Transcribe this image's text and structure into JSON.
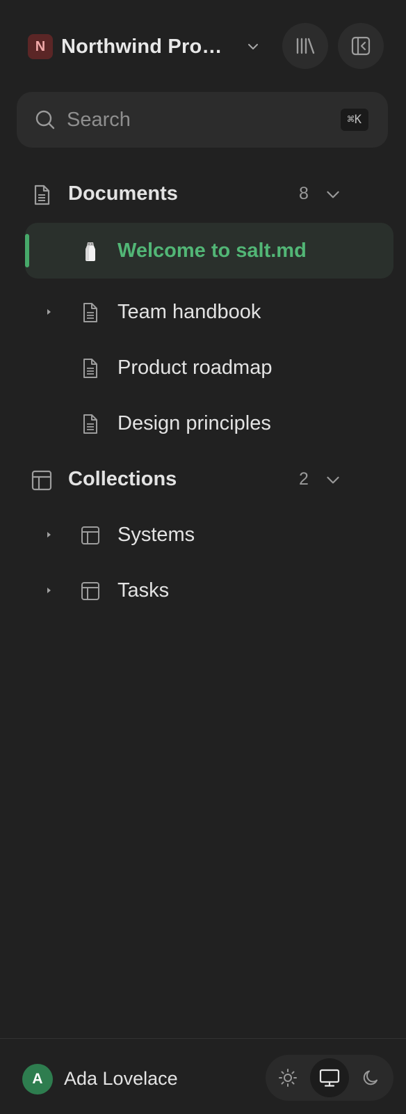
{
  "workspace": {
    "badge": "N",
    "name": "Northwind Pro…"
  },
  "search": {
    "placeholder": "Search",
    "shortcut": "⌘K"
  },
  "documents": {
    "title": "Documents",
    "count": "8",
    "items": [
      {
        "label": "Welcome to salt.md",
        "icon": "salt-shaker-icon",
        "active": true,
        "expandable": false
      },
      {
        "label": "Team handbook",
        "icon": "document-icon",
        "active": false,
        "expandable": true
      },
      {
        "label": "Product roadmap",
        "icon": "document-icon",
        "active": false,
        "expandable": false
      },
      {
        "label": "Design principles",
        "icon": "document-icon",
        "active": false,
        "expandable": false
      }
    ]
  },
  "collections": {
    "title": "Collections",
    "count": "2",
    "items": [
      {
        "label": "Systems",
        "icon": "table-icon",
        "expandable": true
      },
      {
        "label": "Tasks",
        "icon": "table-icon",
        "expandable": true
      }
    ]
  },
  "user": {
    "initial": "A",
    "name": "Ada Lovelace"
  },
  "theme": {
    "options": [
      "light",
      "system",
      "dark"
    ],
    "selected": "system"
  },
  "colors": {
    "accent": "#52b676",
    "background": "#212121",
    "badge": "#5b2626",
    "avatar": "#2e7d4f"
  }
}
